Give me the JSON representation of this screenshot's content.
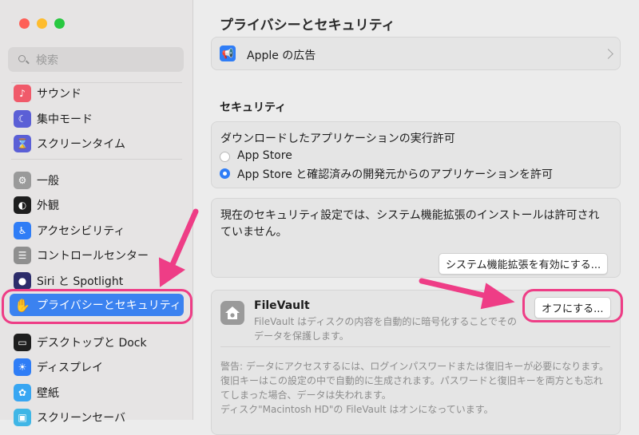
{
  "window": {
    "title": "プライバシーとセキュリティ"
  },
  "search": {
    "placeholder": "検索"
  },
  "sidebar": {
    "items": [
      {
        "label": "サウンド",
        "icon": "speaker-icon",
        "color": "#f05a6a"
      },
      {
        "label": "集中モード",
        "icon": "moon-icon",
        "color": "#5b5fd6"
      },
      {
        "label": "スクリーンタイム",
        "icon": "hourglass-icon",
        "color": "#5b5fd6"
      },
      {
        "label": "一般",
        "icon": "gear-icon",
        "color": "#9a9a9a"
      },
      {
        "label": "外観",
        "icon": "appearance-icon",
        "color": "#1e1e1e"
      },
      {
        "label": "アクセシビリティ",
        "icon": "accessibility-icon",
        "color": "#2f7df6"
      },
      {
        "label": "コントロールセンター",
        "icon": "toggles-icon",
        "color": "#8f8f8f"
      },
      {
        "label": "Siri と Spotlight",
        "icon": "siri-icon",
        "color": "#2c2c6a"
      },
      {
        "label": "プライバシーとセキュリティ",
        "icon": "hand-icon",
        "color": "#3b82f0"
      },
      {
        "label": "デスクトップと Dock",
        "icon": "dock-icon",
        "color": "#1e1e1e"
      },
      {
        "label": "ディスプレイ",
        "icon": "sun-icon",
        "color": "#2f7df6"
      },
      {
        "label": "壁紙",
        "icon": "flower-icon",
        "color": "#38a6f2"
      },
      {
        "label": "スクリーンセーバ",
        "icon": "screensaver-icon",
        "color": "#3fb6e6"
      }
    ]
  },
  "apple_ads": {
    "label": "Apple の広告"
  },
  "security": {
    "title": "セキュリティ",
    "download_label": "ダウンロードしたアプリケーションの実行許可",
    "options": [
      "App Store",
      "App Store と確認済みの開発元からのアプリケーションを許可"
    ],
    "extension_text": "現在のセキュリティ設定では、システム機能拡張のインストールは許可されていません。",
    "extension_button": "システム機能拡張を有効にする..."
  },
  "filevault": {
    "title": "FileVault",
    "description": "FileVault はディスクの内容を自動的に暗号化することでそのデータを保護します。",
    "button": "オフにする...",
    "warning": "警告: データにアクセスするには、ログインパスワードまたは復旧キーが必要になります。復旧キーはこの設定の中で自動的に生成されます。パスワードと復旧キーを両方とも忘れてしまった場合、データは失われます。",
    "status": "ディスク\"Macintosh HD\"の FileVault はオンになっています。"
  },
  "colors": {
    "accent": "#3b82f0",
    "annotation": "#ee3d86"
  }
}
